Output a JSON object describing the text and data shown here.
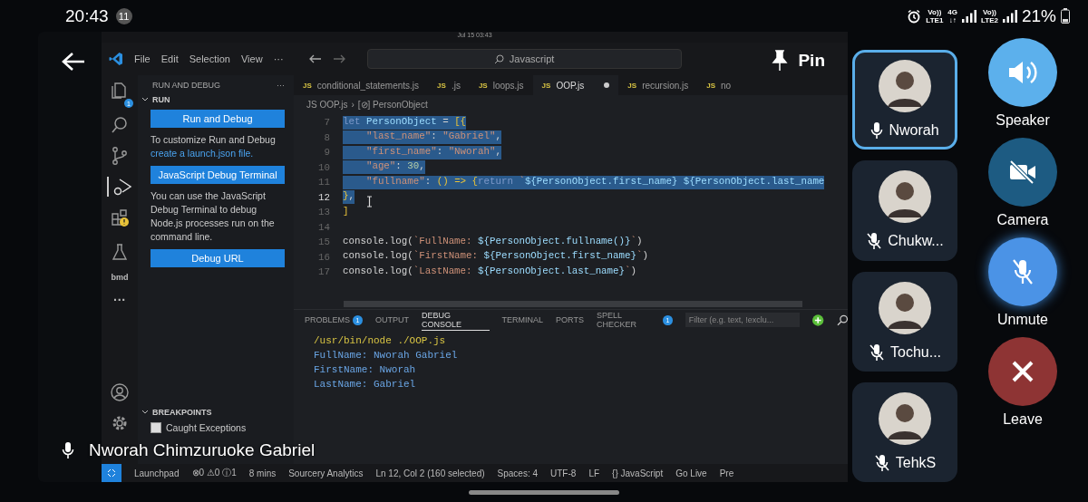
{
  "status_bar": {
    "time": "20:43",
    "notification_count": "11",
    "sims": [
      {
        "top": "Vo))",
        "bottom": "LTE1"
      },
      {
        "top": "4G",
        "bottom": "↓↑"
      },
      {
        "top": "Vo))",
        "bottom": "LTE2"
      }
    ],
    "battery": "21%"
  },
  "share": {
    "presenter": "Nworah Chimzuruoke Gabriel",
    "pin_label": "Pin",
    "screen": {
      "clock": "Jul 15 03:43",
      "menu": [
        "File",
        "Edit",
        "Selection",
        "View",
        "···"
      ],
      "search": "Javascript",
      "files_badge": "1",
      "activity_label": "bmd",
      "activity_more": "···",
      "sidebar": {
        "title": "RUN AND DEBUG",
        "more": "···",
        "section": "RUN",
        "items": [
          {
            "kind": "button",
            "text": "Run and Debug"
          },
          {
            "kind": "text",
            "text": "To customize Run and Debug",
            "link": "create a launch.json file."
          },
          {
            "kind": "button",
            "text": "JavaScript Debug Terminal"
          },
          {
            "kind": "text",
            "text": "You can use the JavaScript Debug Terminal to debug Node.js processes run on the command line."
          },
          {
            "kind": "button",
            "text": "Debug URL"
          }
        ],
        "breakpoints_title": "BREAKPOINTS",
        "breakpoints": [
          {
            "label": "Caught Exceptions",
            "checked": false
          }
        ]
      },
      "tabs": [
        {
          "icon": "JS",
          "label": "conditional_statements.js",
          "selected": false,
          "modified": false
        },
        {
          "icon": "JS",
          "label": ".js",
          "selected": false,
          "modified": false
        },
        {
          "icon": "JS",
          "label": "loops.js",
          "selected": false,
          "modified": false
        },
        {
          "icon": "JS",
          "label": "OOP.js",
          "selected": true,
          "modified": true
        },
        {
          "icon": "JS",
          "label": "recursion.js",
          "selected": false,
          "modified": false
        },
        {
          "icon": "JS",
          "label": "no",
          "selected": false,
          "modified": false
        }
      ],
      "breadcrumb": [
        {
          "icon": "JS",
          "label": "OOP.js"
        },
        {
          "icon": "[⊘]",
          "label": "PersonObject"
        }
      ],
      "breadcrumb_separator": "›",
      "code": [
        {
          "number": "7",
          "selected": true,
          "current": false,
          "tokens": [
            {
              "kind": "kw",
              "text": "let "
            },
            {
              "kind": "var",
              "text": "PersonObject"
            },
            {
              "kind": "punc",
              "text": " = "
            },
            {
              "kind": "br",
              "text": "[{"
            }
          ]
        },
        {
          "number": "8",
          "selected": true,
          "current": false,
          "tokens": [
            {
              "kind": "str",
              "text": "    \"last_name\""
            },
            {
              "kind": "punc",
              "text": ": "
            },
            {
              "kind": "str",
              "text": "\"Gabriel\""
            },
            {
              "kind": "punc",
              "text": ","
            }
          ]
        },
        {
          "number": "9",
          "selected": true,
          "current": false,
          "tokens": [
            {
              "kind": "str",
              "text": "    \"first_name\""
            },
            {
              "kind": "punc",
              "text": ": "
            },
            {
              "kind": "str",
              "text": "\"Nworah\""
            },
            {
              "kind": "punc",
              "text": ","
            }
          ]
        },
        {
          "number": "10",
          "selected": true,
          "current": false,
          "tokens": [
            {
              "kind": "str",
              "text": "    \"age\""
            },
            {
              "kind": "punc",
              "text": ": "
            },
            {
              "kind": "num",
              "text": "30"
            },
            {
              "kind": "punc",
              "text": ","
            }
          ]
        },
        {
          "number": "11",
          "selected": true,
          "current": false,
          "tokens": [
            {
              "kind": "str",
              "text": "    \"fullname\""
            },
            {
              "kind": "punc",
              "text": ": "
            },
            {
              "kind": "br",
              "text": "() => {"
            },
            {
              "kind": "kw",
              "text": "return "
            },
            {
              "kind": "str",
              "text": "`"
            },
            {
              "kind": "var",
              "text": "${PersonObject.first_name}"
            },
            {
              "kind": "var",
              "text": " ${PersonObject.last_name"
            }
          ]
        },
        {
          "number": "12",
          "selected": true,
          "current": true,
          "tokens": [
            {
              "kind": "br",
              "text": "}"
            },
            {
              "kind": "punc",
              "text": ","
            }
          ]
        },
        {
          "number": "13",
          "selected": false,
          "current": false,
          "tokens": [
            {
              "kind": "br",
              "text": "]"
            }
          ]
        },
        {
          "number": "14",
          "selected": false,
          "current": false
        },
        {
          "number": "15",
          "selected": false,
          "current": false,
          "tokens": [
            {
              "kind": "plain",
              "text": "console.log("
            },
            {
              "kind": "str",
              "text": "`FullName: "
            },
            {
              "kind": "var",
              "text": "${PersonObject.fullname()}"
            },
            {
              "kind": "str",
              "text": "`"
            },
            {
              "kind": "plain",
              "text": ")"
            }
          ]
        },
        {
          "number": "16",
          "selected": false,
          "current": false,
          "tokens": [
            {
              "kind": "plain",
              "text": "console.log("
            },
            {
              "kind": "str",
              "text": "`FirstName: "
            },
            {
              "kind": "var",
              "text": "${PersonObject.first_name}"
            },
            {
              "kind": "str",
              "text": "`"
            },
            {
              "kind": "plain",
              "text": ")"
            }
          ]
        },
        {
          "number": "17",
          "selected": false,
          "current": false,
          "tokens": [
            {
              "kind": "plain",
              "text": "console.log("
            },
            {
              "kind": "str",
              "text": "`LastName: "
            },
            {
              "kind": "var",
              "text": "${PersonObject.last_name}"
            },
            {
              "kind": "str",
              "text": "`"
            },
            {
              "kind": "plain",
              "text": ")"
            }
          ]
        }
      ],
      "panel_tabs": [
        {
          "label": "PROBLEMS",
          "badge": "1",
          "selected": false
        },
        {
          "label": "OUTPUT",
          "selected": false
        },
        {
          "label": "DEBUG CONSOLE",
          "selected": true
        },
        {
          "label": "TERMINAL",
          "selected": false
        },
        {
          "label": "PORTS",
          "selected": false
        },
        {
          "label": "SPELL CHECKER",
          "badge": "1",
          "selected": false
        }
      ],
      "filter_placeholder": "Filter (e.g. text, !exclu...",
      "console": [
        {
          "kind": "command",
          "text": "/usr/bin/node ./OOP.js"
        },
        {
          "kind": "output",
          "text": "FullName: Nworah Gabriel"
        },
        {
          "kind": "output",
          "text": "FirstName: Nworah"
        },
        {
          "kind": "output",
          "text": "LastName: Gabriel"
        }
      ],
      "status_items": [
        "Launchpad",
        "⊗0 ⚠0 ⓘ1",
        "8 mins",
        "Sourcery Analytics",
        "Ln 12, Col 2 (160 selected)",
        "Spaces: 4",
        "UTF-8",
        "LF",
        "{} JavaScript",
        "Go Live",
        "Pre"
      ]
    }
  },
  "participants": [
    {
      "name": "Nworah",
      "muted": false,
      "selected": true
    },
    {
      "name": "Chukw...",
      "muted": true,
      "selected": false
    },
    {
      "name": "Tochu...",
      "muted": true,
      "selected": false
    },
    {
      "name": "TehkS",
      "muted": true,
      "selected": false
    }
  ],
  "controls": [
    {
      "kind": "speaker",
      "label": "Speaker",
      "color": "#5cb0ec"
    },
    {
      "kind": "camera",
      "label": "Camera",
      "color": "#1d5b82"
    },
    {
      "kind": "mic",
      "label": "Unmute",
      "color": "#4b93e6"
    },
    {
      "kind": "leave",
      "label": "Leave",
      "color": "#8e3434"
    }
  ]
}
